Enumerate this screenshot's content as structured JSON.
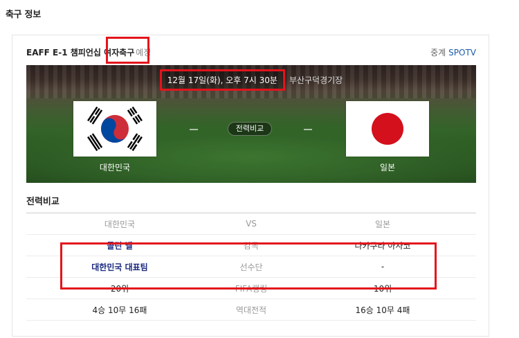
{
  "page": {
    "title": "축구 정보"
  },
  "match": {
    "league": "EAFF E-1 챔피언십 여자축구",
    "status": "예정",
    "broadcast_label": "중계",
    "broadcast_channel": "SPOTV",
    "datetime": "12월 17일(화), 오후 7시 30분",
    "venue": "부산구덕경기장",
    "compare_button": "전력비교",
    "home": {
      "name": "대한민국",
      "flag_icon": "south-korea-flag-icon"
    },
    "away": {
      "name": "일본",
      "flag_icon": "japan-flag-icon"
    }
  },
  "comparison": {
    "title": "전력비교",
    "header": {
      "home": "대한민국",
      "mid": "VS",
      "away": "일본"
    },
    "rows": [
      {
        "home": "콜린 벨",
        "label": "감독",
        "away": "다카쿠라 아사코"
      },
      {
        "home": "대한민국 대표팀",
        "label": "선수단",
        "away": "-"
      },
      {
        "home": "20위",
        "label": "FIFA랭킹",
        "away": "10위"
      },
      {
        "home": "4승 10무 16패",
        "label": "역대전적",
        "away": "16승 10무 4패"
      }
    ]
  },
  "colors": {
    "highlight": "#e3141b",
    "link": "#1a2a80",
    "channel": "#1a5ba8"
  }
}
